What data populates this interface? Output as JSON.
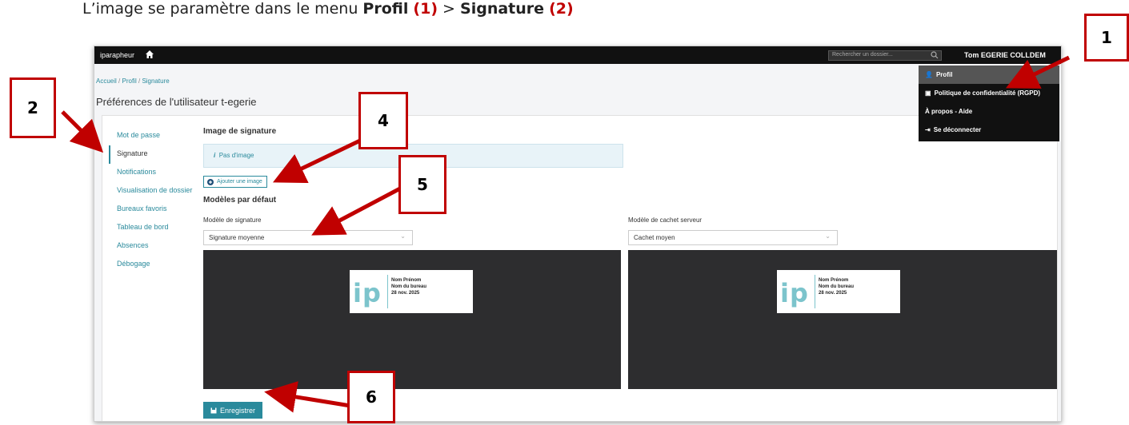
{
  "caption": {
    "prefix": "L’image se paramètre dans le menu ",
    "menu1": "Profil",
    "num1": "(1)",
    "sep": " > ",
    "menu2": "Signature",
    "num2": "(2)"
  },
  "topbar": {
    "brand": "iparapheur",
    "search_placeholder": "Rechercher un dossier...",
    "user": "Tom EGERIE COLLDEM"
  },
  "breadcrumb": [
    "Accueil",
    "Profil",
    "Signature"
  ],
  "page_title": "Préférences de l'utilisateur t-egerie",
  "sidebar": {
    "items": [
      {
        "label": "Mot de passe"
      },
      {
        "label": "Signature"
      },
      {
        "label": "Notifications"
      },
      {
        "label": "Visualisation de dossier"
      },
      {
        "label": "Bureaux favoris"
      },
      {
        "label": "Tableau de bord"
      },
      {
        "label": "Absences"
      },
      {
        "label": "Débogage"
      }
    ],
    "active_index": 1
  },
  "signature_image": {
    "heading": "Image de signature",
    "info": "Pas d'image",
    "add_button": "Ajouter une image"
  },
  "models": {
    "heading": "Modèles par défaut",
    "signature": {
      "label": "Modèle de signature",
      "value": "Signature moyenne"
    },
    "stamp": {
      "label": "Modèle de cachet serveur",
      "value": "Cachet moyen"
    },
    "card": {
      "logo": "ip",
      "line1": "Nom Prénom",
      "line2": "Nom du bureau",
      "line3": "28 nov. 2025"
    }
  },
  "save_button": "Enregistrer",
  "dropdown": {
    "items": [
      "Profil",
      "Politique de confidentialité (RGPD)",
      "À propos - Aide",
      "Se déconnecter"
    ]
  },
  "callouts": [
    "1",
    "2",
    "4",
    "5",
    "6"
  ],
  "colors": {
    "accent": "#2a8a9c",
    "callout_red": "#c00000",
    "topbar": "#111111",
    "preview_bg": "#2d2d2f"
  }
}
